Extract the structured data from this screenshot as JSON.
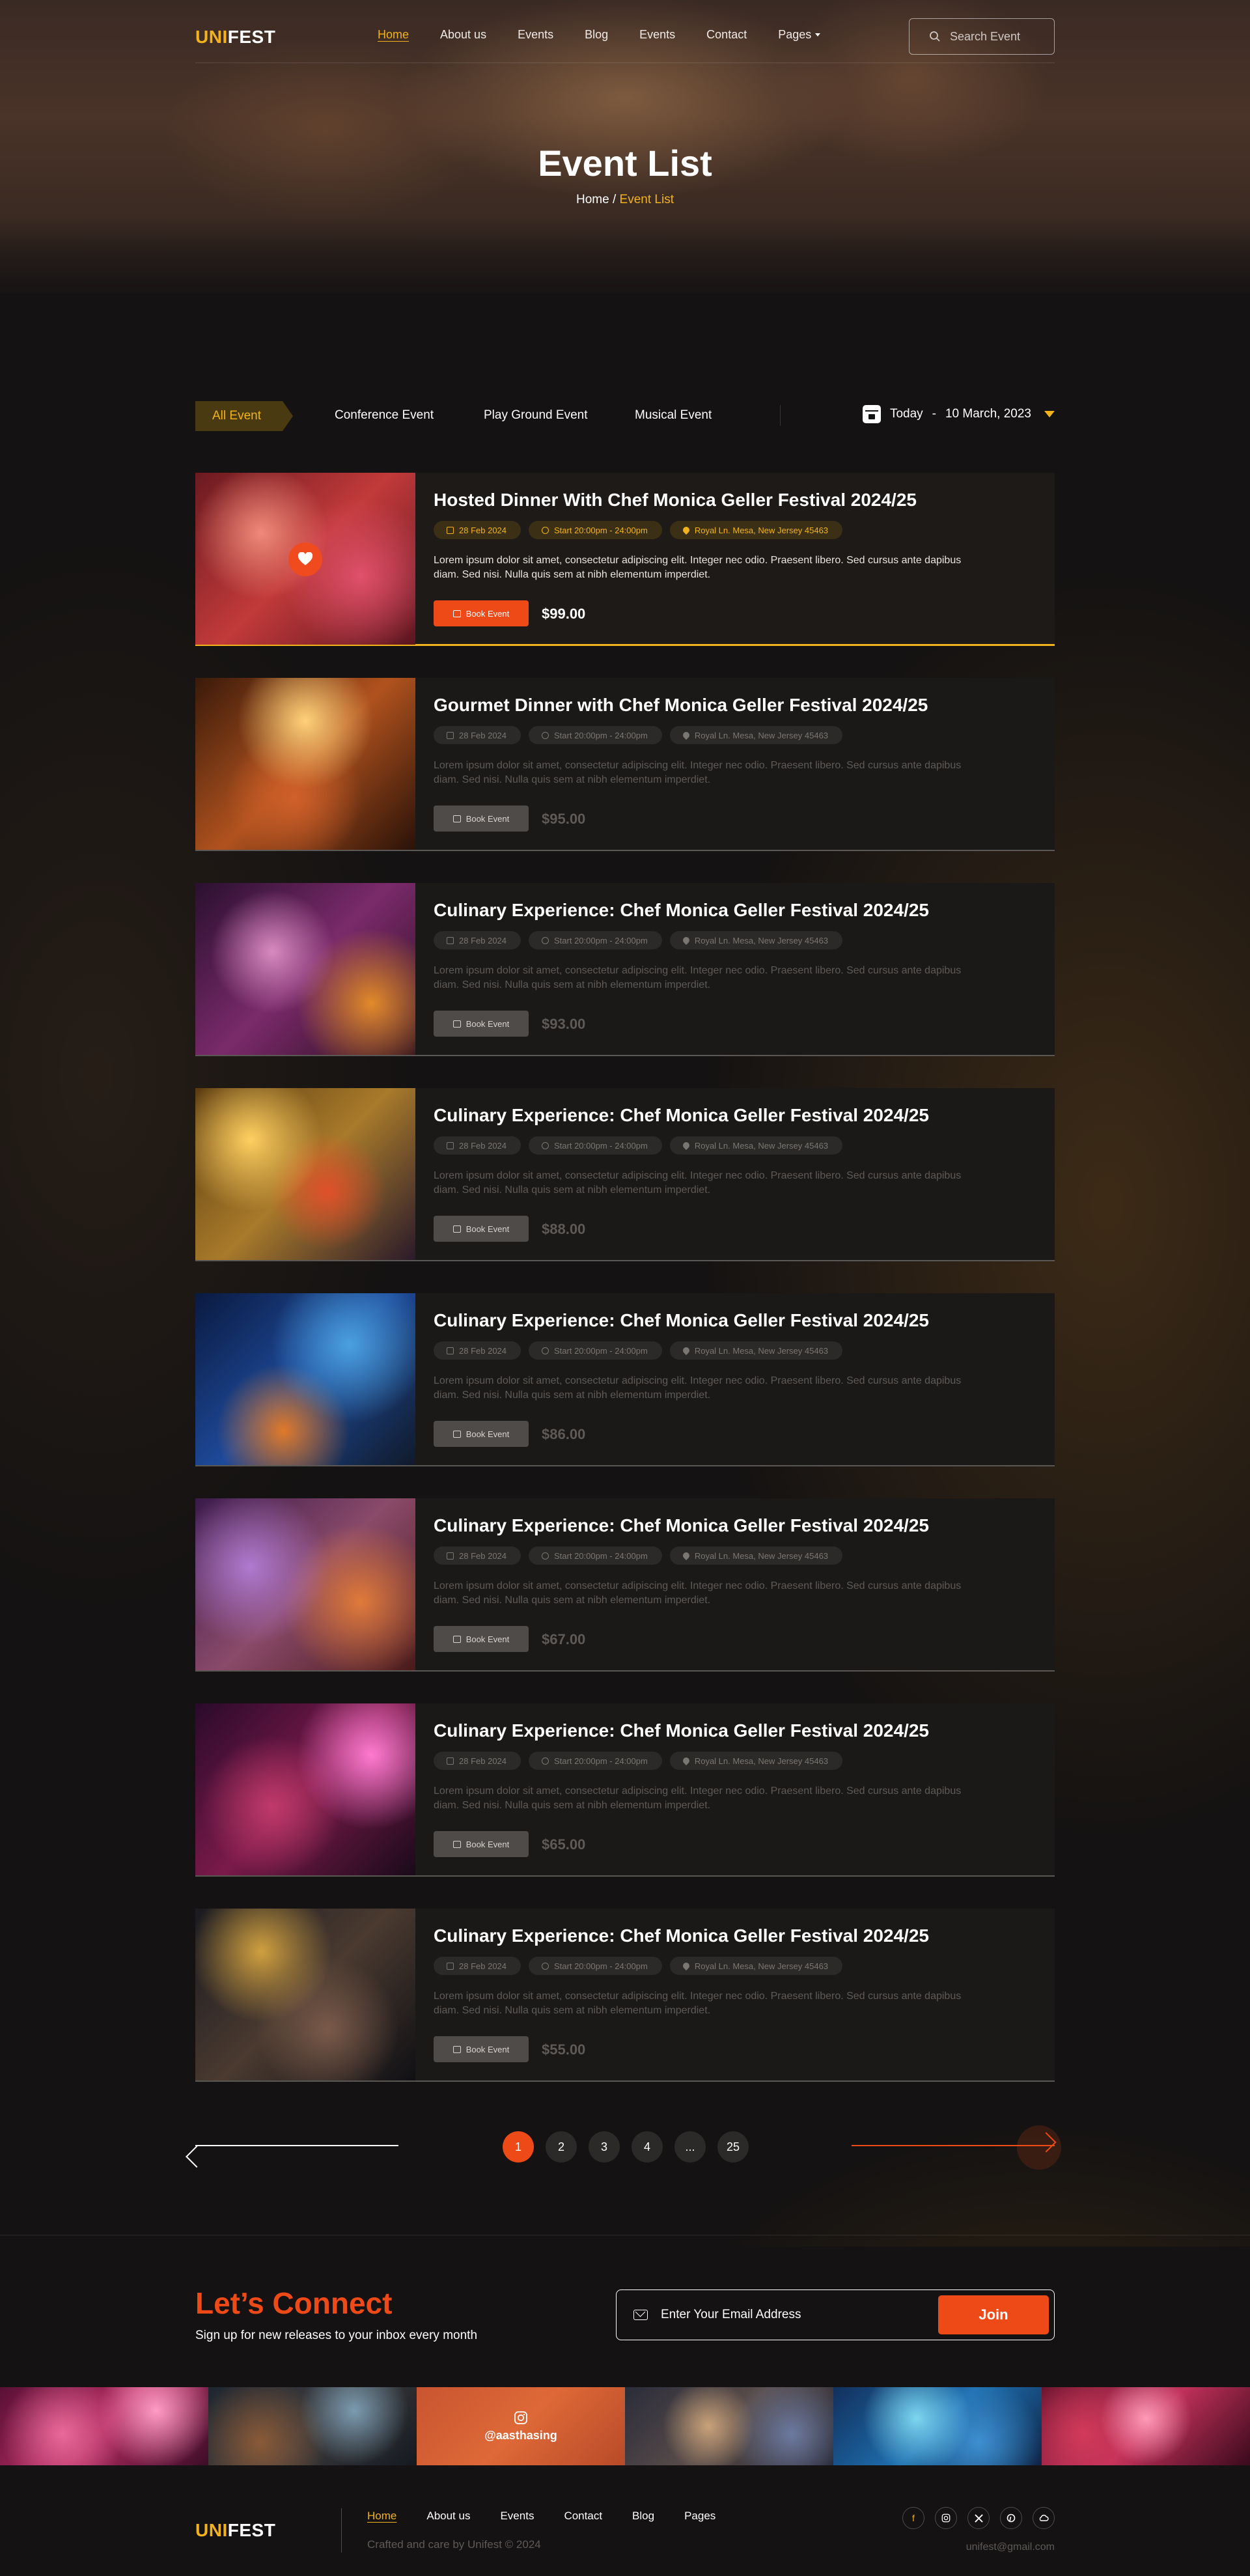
{
  "brand": {
    "logo_part1": "UNI",
    "logo_part2": "FEST",
    "accent": "#f2b21b",
    "cta": "#ed4a17"
  },
  "nav": {
    "items": [
      {
        "label": "Home",
        "active": true
      },
      {
        "label": "About us"
      },
      {
        "label": "Events"
      },
      {
        "label": "Blog"
      },
      {
        "label": "Events"
      },
      {
        "label": "Contact"
      },
      {
        "label": "Pages",
        "dropdown": true
      }
    ],
    "search_placeholder": "Search Event"
  },
  "hero": {
    "title": "Event List",
    "breadcrumb_home": "Home",
    "breadcrumb_sep": "/",
    "breadcrumb_current": "Event List"
  },
  "filter": {
    "tabs": [
      "All Event",
      "Conference Event",
      "Play Ground Event",
      "Musical Event"
    ],
    "active_tab": "All Event",
    "date_label": "Today",
    "date_sep": "-",
    "date_value": "10 March, 2023"
  },
  "events": [
    {
      "title": "Hosted Dinner With Chef Monica Geller Festival 2024/25",
      "date": "28 Feb 2024",
      "time": "Start 20:00pm - 24:00pm",
      "location": "Royal Ln. Mesa, New Jersey 45463",
      "description": "Lorem ipsum dolor sit amet, consectetur adipiscing elit. Integer nec odio. Praesent libero. Sed cursus ante dapibus diam. Sed nisi. Nulla quis sem at nibh elementum imperdiet.",
      "button": "Book Event",
      "price": "$99.00",
      "featured": true
    },
    {
      "title": "Gourmet Dinner with Chef Monica Geller Festival 2024/25",
      "date": "28 Feb 2024",
      "time": "Start 20:00pm - 24:00pm",
      "location": "Royal Ln. Mesa, New Jersey 45463",
      "description": "Lorem ipsum dolor sit amet, consectetur adipiscing elit. Integer nec odio. Praesent libero. Sed cursus ante dapibus diam. Sed nisi. Nulla quis sem at nibh elementum imperdiet.",
      "button": "Book Event",
      "price": "$95.00"
    },
    {
      "title": "Culinary Experience: Chef Monica Geller Festival 2024/25",
      "date": "28 Feb 2024",
      "time": "Start 20:00pm - 24:00pm",
      "location": "Royal Ln. Mesa, New Jersey 45463",
      "description": "Lorem ipsum dolor sit amet, consectetur adipiscing elit. Integer nec odio. Praesent libero. Sed cursus ante dapibus diam. Sed nisi. Nulla quis sem at nibh elementum imperdiet.",
      "button": "Book Event",
      "price": "$93.00"
    },
    {
      "title": "Culinary Experience: Chef Monica Geller Festival 2024/25",
      "date": "28 Feb 2024",
      "time": "Start 20:00pm - 24:00pm",
      "location": "Royal Ln. Mesa, New Jersey 45463",
      "description": "Lorem ipsum dolor sit amet, consectetur adipiscing elit. Integer nec odio. Praesent libero. Sed cursus ante dapibus diam. Sed nisi. Nulla quis sem at nibh elementum imperdiet.",
      "button": "Book Event",
      "price": "$88.00"
    },
    {
      "title": "Culinary Experience: Chef Monica Geller Festival 2024/25",
      "date": "28 Feb 2024",
      "time": "Start 20:00pm - 24:00pm",
      "location": "Royal Ln. Mesa, New Jersey 45463",
      "description": "Lorem ipsum dolor sit amet, consectetur adipiscing elit. Integer nec odio. Praesent libero. Sed cursus ante dapibus diam. Sed nisi. Nulla quis sem at nibh elementum imperdiet.",
      "button": "Book Event",
      "price": "$86.00"
    },
    {
      "title": "Culinary Experience: Chef Monica Geller Festival 2024/25",
      "date": "28 Feb 2024",
      "time": "Start 20:00pm - 24:00pm",
      "location": "Royal Ln. Mesa, New Jersey 45463",
      "description": "Lorem ipsum dolor sit amet, consectetur adipiscing elit. Integer nec odio. Praesent libero. Sed cursus ante dapibus diam. Sed nisi. Nulla quis sem at nibh elementum imperdiet.",
      "button": "Book Event",
      "price": "$67.00"
    },
    {
      "title": "Culinary Experience: Chef Monica Geller Festival 2024/25",
      "date": "28 Feb 2024",
      "time": "Start 20:00pm - 24:00pm",
      "location": "Royal Ln. Mesa, New Jersey 45463",
      "description": "Lorem ipsum dolor sit amet, consectetur adipiscing elit. Integer nec odio. Praesent libero. Sed cursus ante dapibus diam. Sed nisi. Nulla quis sem at nibh elementum imperdiet.",
      "button": "Book Event",
      "price": "$65.00"
    },
    {
      "title": "Culinary Experience: Chef Monica Geller Festival 2024/25",
      "date": "28 Feb 2024",
      "time": "Start 20:00pm - 24:00pm",
      "location": "Royal Ln. Mesa, New Jersey 45463",
      "description": "Lorem ipsum dolor sit amet, consectetur adipiscing elit. Integer nec odio. Praesent libero. Sed cursus ante dapibus diam. Sed nisi. Nulla quis sem at nibh elementum imperdiet.",
      "button": "Book Event",
      "price": "$55.00"
    }
  ],
  "pagination": {
    "pages": [
      "1",
      "2",
      "3",
      "4",
      "...",
      "25"
    ],
    "current": "1"
  },
  "newsletter": {
    "title": "Let’s Connect",
    "subtitle": "Sign up for new releases to your inbox every month",
    "email_placeholder": "Enter Your Email Address",
    "button": "Join"
  },
  "instagram": {
    "handle": "@aasthasing"
  },
  "footer": {
    "nav": [
      {
        "label": "Home",
        "active": true
      },
      {
        "label": "About us"
      },
      {
        "label": "Events"
      },
      {
        "label": "Contact"
      },
      {
        "label": "Blog"
      },
      {
        "label": "Pages"
      }
    ],
    "copyright": "Crafted and care by Unifest © 2024",
    "email": "unifest@gmail.com",
    "socials": [
      "facebook-icon",
      "instagram-icon",
      "x-icon",
      "pinterest-icon",
      "cloud-icon"
    ]
  }
}
